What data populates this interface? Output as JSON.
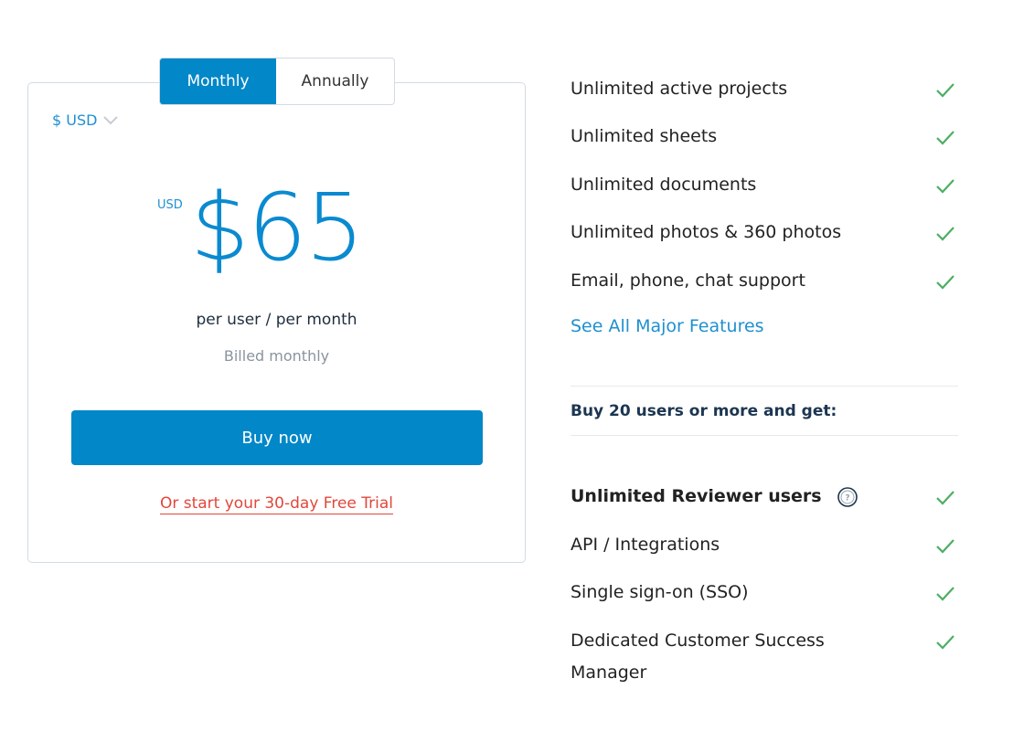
{
  "billing_toggle": {
    "options": [
      {
        "label": "Monthly",
        "active": true
      },
      {
        "label": "Annually",
        "active": false
      }
    ]
  },
  "currency_select": {
    "value": "$ USD",
    "icon": "chevron-down-icon"
  },
  "price": {
    "currency_code": "USD",
    "amount": "$65",
    "per_label": "per user / per month",
    "billing_note": "Billed monthly"
  },
  "actions": {
    "buy_label": "Buy now",
    "trial_label": "Or start your 30-day Free Trial"
  },
  "features": {
    "items": [
      {
        "label": "Unlimited active projects",
        "included": true
      },
      {
        "label": "Unlimited sheets",
        "included": true
      },
      {
        "label": "Unlimited documents",
        "included": true
      },
      {
        "label": "Unlimited photos & 360 photos",
        "included": true
      },
      {
        "label": "Email, phone, chat support",
        "included": true
      }
    ],
    "see_all_label": "See All Major Features"
  },
  "volume": {
    "heading": "Buy 20 users or more and get:",
    "items": [
      {
        "label": "Unlimited Reviewer users",
        "included": true,
        "help_icon": "question-circle-icon"
      },
      {
        "label": "API / Integrations",
        "included": true
      },
      {
        "label": "Single sign-on (SSO)",
        "included": true
      },
      {
        "label": "Dedicated Customer Success Manager",
        "included": true
      }
    ]
  },
  "colors": {
    "primary": "#0287c8",
    "link": "#1e90cf",
    "trial_link": "#e2473b",
    "check": "#4caf63",
    "heading_dark": "#1c3651"
  }
}
